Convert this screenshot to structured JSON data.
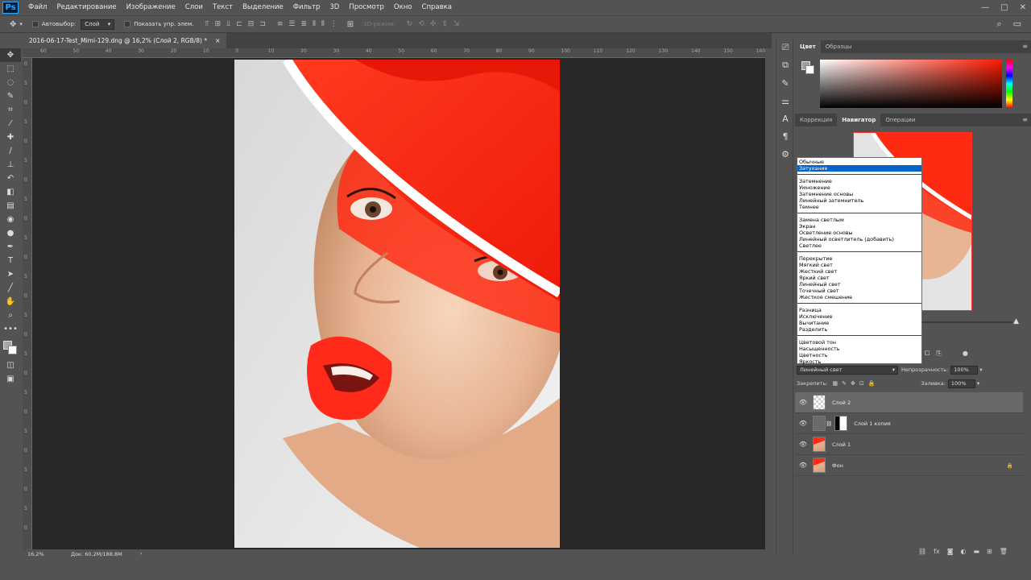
{
  "app": {
    "logo": "Ps"
  },
  "menu": [
    "Файл",
    "Редактирование",
    "Изображение",
    "Слои",
    "Текст",
    "Выделение",
    "Фильтр",
    "3D",
    "Просмотр",
    "Окно",
    "Справка"
  ],
  "window_controls": {
    "minimize": "—",
    "maximize": "□",
    "close": "✕"
  },
  "options": {
    "auto_select_label": "Автовыбор:",
    "auto_select_value": "Слой",
    "show_transform_label": "Показать упр. элем.",
    "mode_3d_label": "3D-режим:"
  },
  "document": {
    "tab_title": "2016-06-17-Test_Mimi-129.dng @ 16,2% (Слой 2, RGB/8) *",
    "tab_close": "×"
  },
  "ruler_top": [
    "60",
    "50",
    "40",
    "30",
    "20",
    "10",
    "0",
    "10",
    "20",
    "30",
    "40",
    "50",
    "60",
    "70",
    "80",
    "90",
    "100",
    "110",
    "120",
    "130",
    "140",
    "150",
    "160"
  ],
  "ruler_left": [
    "0",
    "5",
    "0",
    "5",
    "0",
    "5",
    "0",
    "5",
    "0",
    "5",
    "0",
    "5",
    "0",
    "5",
    "0",
    "5",
    "0",
    "5",
    "0",
    "5",
    "0",
    "5",
    "0",
    "5",
    "0"
  ],
  "status": {
    "zoom": "16,2%",
    "doc_info": "Док: 60,2M/188,8M",
    "arrow": "›"
  },
  "color_panel": {
    "tabs": [
      "Цвет",
      "Образцы"
    ]
  },
  "nav_panel": {
    "tabs": [
      "Коррекция",
      "Навигатор",
      "Операции"
    ]
  },
  "blend_modes": [
    [
      "Обычные",
      "Затухание"
    ],
    [
      "Затемнение",
      "Умножение",
      "Затемнение основы",
      "Линейный затемнитель",
      "Темнее"
    ],
    [
      "Замена светлым",
      "Экран",
      "Осветление основы",
      "Линейный осветлитель (добавить)",
      "Светлее"
    ],
    [
      "Перекрытие",
      "Мягкий свет",
      "Жесткий свет",
      "Яркий свет",
      "Линейный свет",
      "Точечный свет",
      "Жесткое смешение"
    ],
    [
      "Разница",
      "Исключение",
      "Вычитание",
      "Разделить"
    ],
    [
      "Цветовой тон",
      "Насыщенность",
      "Цветность",
      "Яркость"
    ]
  ],
  "layers_panel": {
    "blend_value": "Линейный свет",
    "opacity_label": "Непрозрачность:",
    "opacity_value": "100%",
    "lock_label": "Закрепить:",
    "fill_label": "Заливка:",
    "fill_value": "100%",
    "layers": [
      {
        "name": "Слой 2",
        "selected": true
      },
      {
        "name": "Слой 1 копия",
        "selected": false
      },
      {
        "name": "Слой 1",
        "selected": false
      },
      {
        "name": "Фон",
        "selected": false
      }
    ]
  },
  "colors": {
    "accent_red": "#ff2a12",
    "selection_blue": "#0064c8",
    "ui_gray": "#535353"
  }
}
